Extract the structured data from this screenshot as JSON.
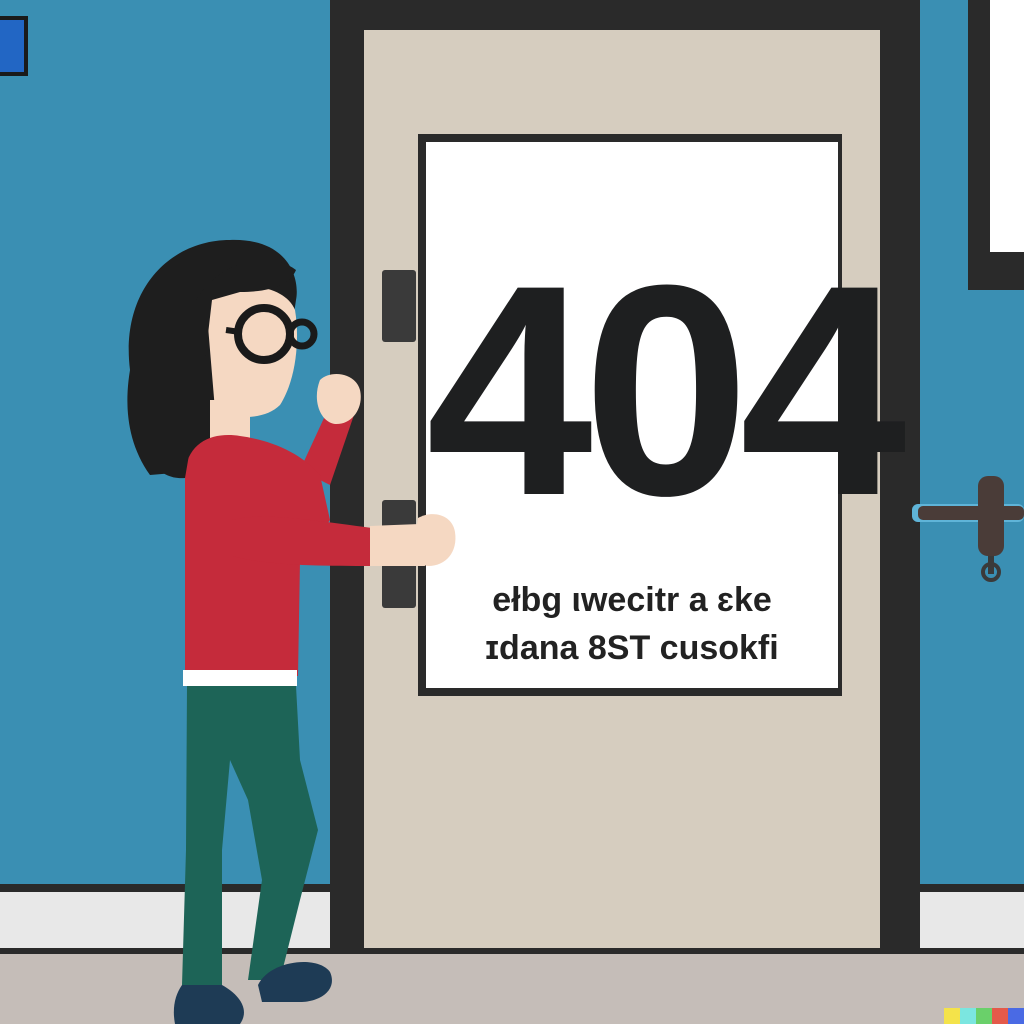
{
  "sign": {
    "number": "404",
    "line1": "ełbg ιwecitr a ɛke",
    "line2": "ɪdana 8ST cusokfi"
  },
  "colors": {
    "wall": "#3a8fb3",
    "door": "#d6cdbf",
    "door_frame": "#2a2a2a",
    "sign": "#ffffff",
    "sweater": "#c52b3b",
    "pants": "#1d6457",
    "hair": "#1e1e1e",
    "floor": "#c5bdb8"
  },
  "icons": [
    "door-handle-icon",
    "glasses-icon"
  ]
}
